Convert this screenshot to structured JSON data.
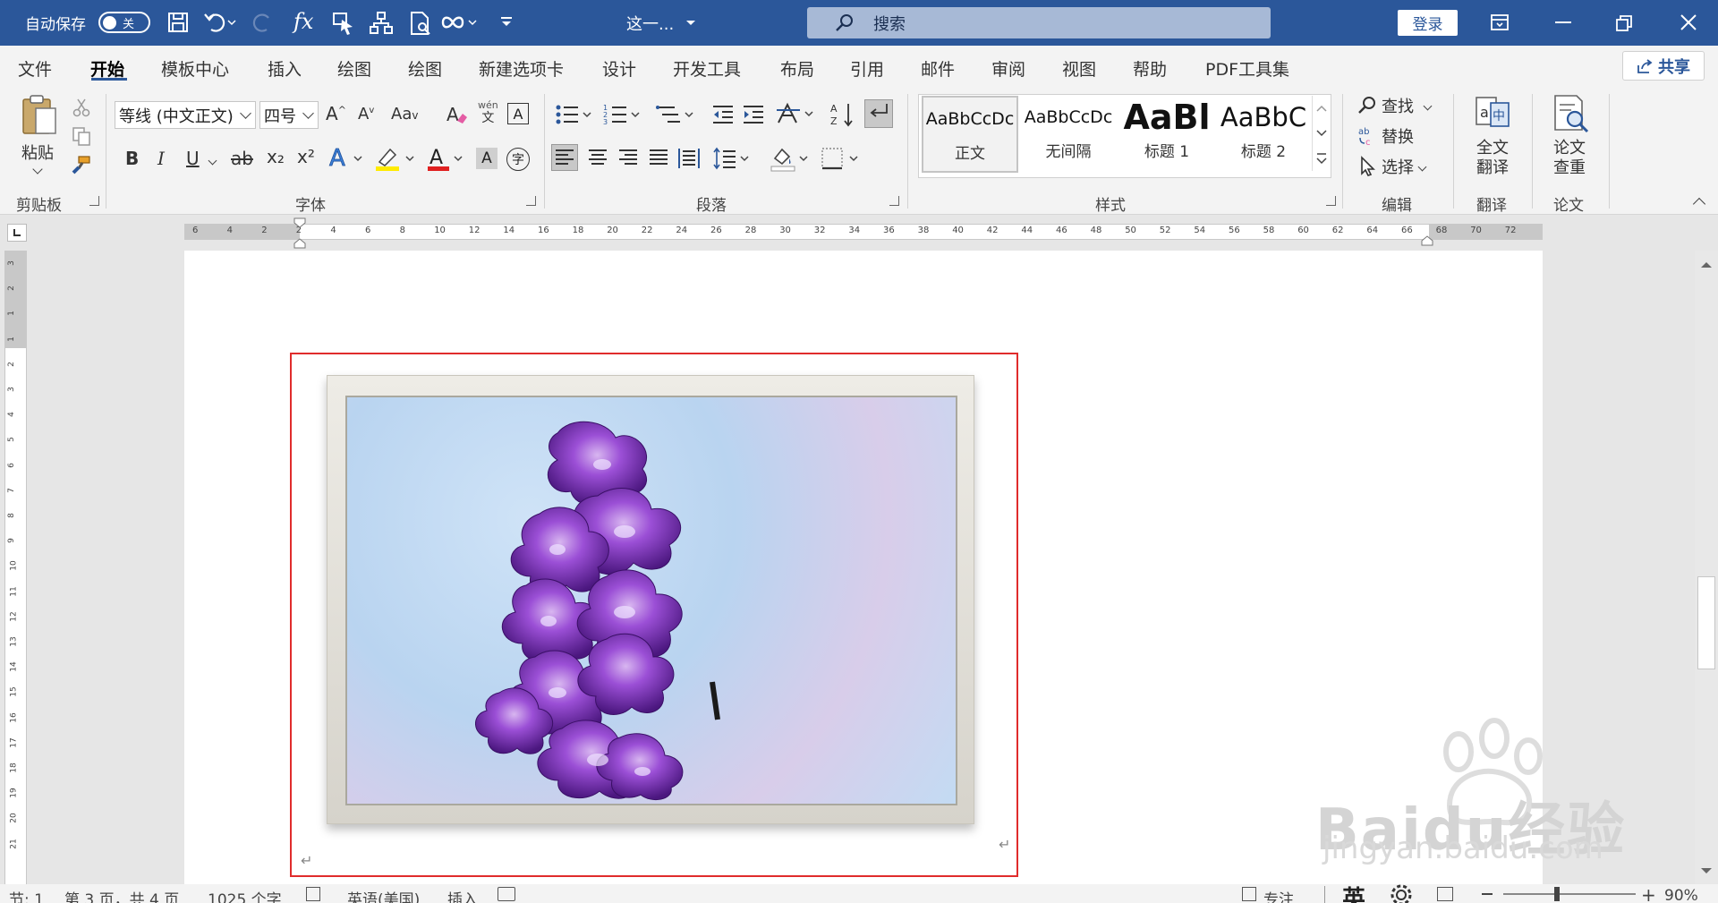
{
  "titlebar": {
    "autosave_label": "自动保存",
    "autosave_state": "关",
    "doc_title": "这一...",
    "search_placeholder": "搜索",
    "login_label": "登录",
    "bg_color": "#2b579a"
  },
  "tabs": [
    "文件",
    "开始",
    "模板中心",
    "插入",
    "绘图",
    "绘图",
    "新建选项卡",
    "设计",
    "开发工具",
    "布局",
    "引用",
    "邮件",
    "审阅",
    "视图",
    "帮助",
    "PDF工具集"
  ],
  "active_tab": "开始",
  "share_label": "共享",
  "ribbon": {
    "clipboard": {
      "paste_label": "粘贴",
      "group_label": "剪贴板"
    },
    "font": {
      "font_name": "等线 (中文正文)",
      "font_size": "四号",
      "group_label": "字体",
      "bold": "B",
      "italic": "I",
      "underline": "U",
      "strike": "ab",
      "subscript": "x₂",
      "superscript": "x²",
      "change_case": "Aa",
      "grow": "A",
      "shrink": "A",
      "phonetic_top": "wén",
      "phonetic_bottom": "文",
      "font_color_letter": "A",
      "shade_letter": "A",
      "enclose": "字"
    },
    "paragraph": {
      "group_label": "段落"
    },
    "styles": {
      "group_label": "样式",
      "items": [
        {
          "sample": "AaBbCcDc",
          "name": "正文"
        },
        {
          "sample": "AaBbCcDc",
          "name": "无间隔"
        },
        {
          "sample": "AaBl",
          "name": "标题 1"
        },
        {
          "sample": "AaBbC",
          "name": "标题 2"
        }
      ]
    },
    "editing": {
      "find": "查找",
      "replace": "替换",
      "select": "选择",
      "group_label": "编辑"
    },
    "translate": {
      "button_line1": "全文",
      "button_line2": "翻译",
      "group_label": "翻译"
    },
    "thesis": {
      "button_line1": "论文",
      "button_line2": "查重",
      "group_label": "论文"
    }
  },
  "ruler_h_labels": [
    "6",
    "4",
    "2",
    "2",
    "4",
    "6",
    "8",
    "10",
    "12",
    "14",
    "16",
    "18",
    "20",
    "22",
    "24",
    "26",
    "28",
    "30",
    "32",
    "34",
    "36",
    "38",
    "40",
    "42",
    "44",
    "46",
    "48",
    "50",
    "52",
    "54",
    "56",
    "58",
    "60",
    "62",
    "64",
    "66",
    "68",
    "70",
    "72"
  ],
  "ruler_v_labels": [
    "3",
    "2",
    "1",
    "1",
    "2",
    "3",
    "4",
    "5",
    "6",
    "7",
    "8",
    "9",
    "10",
    "11",
    "12",
    "13",
    "14",
    "15",
    "16",
    "17",
    "18",
    "19",
    "20",
    "21"
  ],
  "status": {
    "section": "节: 1",
    "page": "第 3 页，共 4 页",
    "words": "1025 个字",
    "language": "英语(美国)",
    "mode": "插入",
    "focus": "专注",
    "ime": "英",
    "zoom": "90%"
  },
  "watermark": {
    "brand": "Baidu经验",
    "url": "jingyan.baidu.com"
  },
  "colors": {
    "accent": "#2b579a",
    "selection_border": "#e02c2c",
    "flower": "#7b2fbf"
  }
}
